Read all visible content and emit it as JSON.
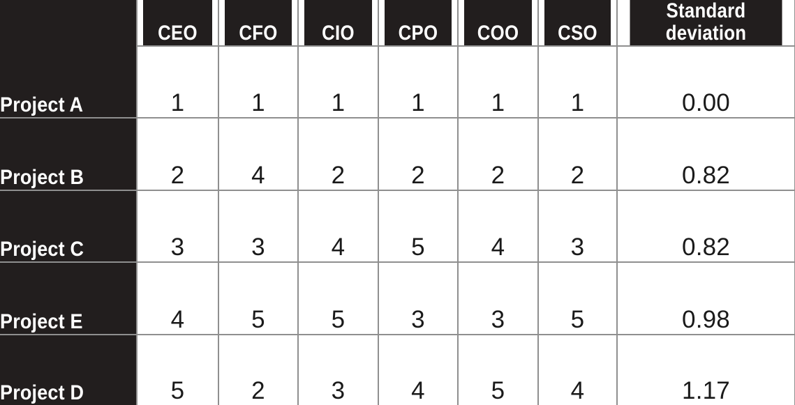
{
  "table": {
    "corner_label": "",
    "columns": [
      {
        "key": "ceo",
        "label": "CEO"
      },
      {
        "key": "cfo",
        "label": "CFO"
      },
      {
        "key": "cio",
        "label": "CIO"
      },
      {
        "key": "cpo",
        "label": "CPO"
      },
      {
        "key": "coo",
        "label": "COO"
      },
      {
        "key": "cso",
        "label": "CSO"
      },
      {
        "key": "stdev",
        "label": "Standard\ndeviation"
      }
    ],
    "rows": [
      {
        "label": "Project A",
        "values": [
          "1",
          "1",
          "1",
          "1",
          "1",
          "1"
        ],
        "stdev": "0.00"
      },
      {
        "label": "Project B",
        "values": [
          "2",
          "4",
          "2",
          "2",
          "2",
          "2"
        ],
        "stdev": "0.82"
      },
      {
        "label": "Project C",
        "values": [
          "3",
          "3",
          "4",
          "5",
          "4",
          "3"
        ],
        "stdev": "0.82"
      },
      {
        "label": "Project E",
        "values": [
          "4",
          "5",
          "5",
          "3",
          "3",
          "5"
        ],
        "stdev": "0.98"
      },
      {
        "label": "Project D",
        "values": [
          "5",
          "2",
          "3",
          "4",
          "5",
          "4"
        ],
        "stdev": "1.17"
      }
    ]
  },
  "colors": {
    "header_background": "#221E1E",
    "header_text": "#FFFFFF",
    "cell_background": "#FFFFFF",
    "cell_text": "#1A1A1A",
    "grid_line": "#8F8F8F"
  }
}
